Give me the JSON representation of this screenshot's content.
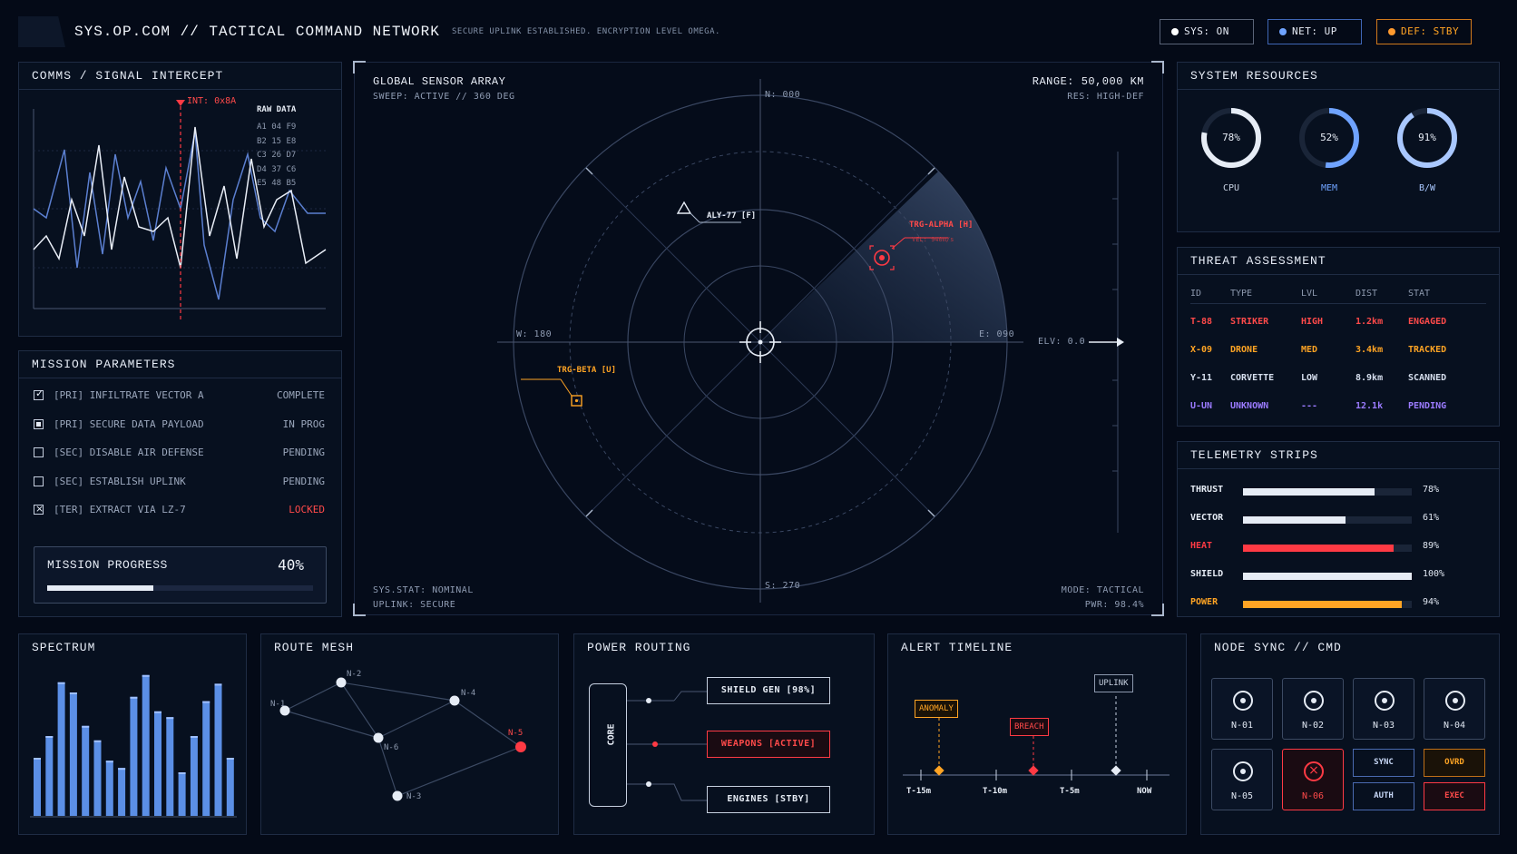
{
  "header": {
    "title": "SYS.OP.COM // TACTICAL COMMAND NETWORK",
    "message": "SECURE UPLINK ESTABLISHED. ENCRYPTION LEVEL OMEGA.",
    "status": [
      {
        "label": "SYS: ON",
        "color": "#ffffff"
      },
      {
        "label": "NET: UP",
        "color": "#6fa3ff"
      },
      {
        "label": "DEF: STBY",
        "color": "#ff9a2e"
      }
    ]
  },
  "comms": {
    "title": "COMMS / SIGNAL INTERCEPT",
    "marker": "INT: 0x8A",
    "raw_title": "RAW DATA",
    "raw_lines": [
      "A1 04 F9",
      "B2 15 E8",
      "C3 26 D7",
      "D4 37 C6",
      "E5 48 B5"
    ]
  },
  "mission": {
    "title": "MISSION PARAMETERS",
    "items": [
      {
        "label": "[PRI] INFILTRATE VECTOR A",
        "status": "COMPLETE",
        "box": "check"
      },
      {
        "label": "[PRI] SECURE DATA PAYLOAD",
        "status": "IN PROG",
        "box": "fill"
      },
      {
        "label": "[SEC] DISABLE AIR DEFENSE",
        "status": "PENDING",
        "box": "empty"
      },
      {
        "label": "[SEC] ESTABLISH UPLINK",
        "status": "PENDING",
        "box": "empty"
      },
      {
        "label": "[TER] EXTRACT VIA LZ-7",
        "status": "LOCKED",
        "box": "x"
      }
    ],
    "progress_label": "MISSION PROGRESS",
    "progress_text": "40%",
    "progress_value": 0.4
  },
  "radar": {
    "title": "GLOBAL SENSOR ARRAY",
    "sweep": "SWEEP: ACTIVE // 360 DEG",
    "range": "RANGE: 50,000 KM",
    "res": "RES: HIGH-DEF",
    "north": "N: 000",
    "south": "S: 270",
    "west": "W: 180",
    "east": "E: 090",
    "elv": "ELV: 0.0",
    "friendly": "ALY-77 [F]",
    "hostile": "TRG-ALPHA [H]",
    "hostile_vel": "VEL: 940m/s",
    "unknown": "TRG-BETA [U]",
    "sys_stat": "SYS.STAT: NOMINAL",
    "uplink": "UPLINK: SECURE",
    "mode": "MODE: TACTICAL",
    "pwr": "PWR: 98.4%"
  },
  "resources": {
    "title": "SYSTEM RESOURCES",
    "gauges": [
      {
        "label": "CPU",
        "text": "78%",
        "value": 0.78,
        "color": "#e6ecf5"
      },
      {
        "label": "MEM",
        "text": "52%",
        "value": 0.52,
        "color": "#6fa3ff"
      },
      {
        "label": "B/W",
        "text": "91%",
        "value": 0.91,
        "color": "#a9c8ff"
      }
    ]
  },
  "threats": {
    "title": "THREAT ASSESSMENT",
    "headers": [
      "ID",
      "TYPE",
      "LVL",
      "DIST",
      "STAT"
    ],
    "rows": [
      {
        "cells": [
          "T-88",
          "STRIKER",
          "HIGH",
          "1.2km",
          "ENGAGED"
        ],
        "color": "#ff4a4a"
      },
      {
        "cells": [
          "X-09",
          "DRONE",
          "MED",
          "3.4km",
          "TRACKED"
        ],
        "color": "#ffa424"
      },
      {
        "cells": [
          "Y-11",
          "CORVETTE",
          "LOW",
          "8.9km",
          "SCANNED"
        ],
        "color": "#d6dfee"
      },
      {
        "cells": [
          "U-UN",
          "UNKNOWN",
          "---",
          "12.1k",
          "PENDING"
        ],
        "color": "#9b7bff"
      }
    ]
  },
  "telemetry": {
    "title": "TELEMETRY STRIPS",
    "rows": [
      {
        "name": "THRUST",
        "text": "78%",
        "value": 0.78,
        "color": "#e6ecf5",
        "name_color": "#e6ecf5"
      },
      {
        "name": "VECTOR",
        "text": "61%",
        "value": 0.61,
        "color": "#e6ecf5",
        "name_color": "#e6ecf5"
      },
      {
        "name": "HEAT",
        "text": "89%",
        "value": 0.89,
        "color": "#ff3a44",
        "name_color": "#ff3a44"
      },
      {
        "name": "SHIELD",
        "text": "100%",
        "value": 1.0,
        "color": "#e6ecf5",
        "name_color": "#e6ecf5"
      },
      {
        "name": "POWER",
        "text": "94%",
        "value": 0.94,
        "color": "#ffa424",
        "name_color": "#ffa424"
      }
    ]
  },
  "spectrum": {
    "title": "SPECTRUM",
    "chart_data": {
      "type": "bar",
      "values": [
        0.4,
        0.55,
        0.92,
        0.85,
        0.62,
        0.52,
        0.38,
        0.33,
        0.82,
        0.97,
        0.72,
        0.68,
        0.3,
        0.55,
        0.79,
        0.91,
        0.4
      ],
      "color": "#5b8fe6"
    }
  },
  "mesh": {
    "title": "ROUTE MESH",
    "nodes": [
      "N-1",
      "N-2",
      "N-4",
      "N-5",
      "N-6",
      "N-3"
    ]
  },
  "power": {
    "title": "POWER ROUTING",
    "core": "CORE",
    "shield": "SHIELD GEN [98%]",
    "weapons": "WEAPONS [ACTIVE]",
    "engines": "ENGINES [STBY]"
  },
  "alerts": {
    "title": "ALERT TIMELINE",
    "events": [
      "ANOMALY",
      "BREACH",
      "UPLINK"
    ],
    "ticks": [
      "T-15m",
      "T-10m",
      "T-5m",
      "NOW"
    ]
  },
  "nodes": {
    "title": "NODE SYNC // CMD",
    "items": [
      "N-01",
      "N-02",
      "N-03",
      "N-04",
      "N-05",
      "N-06"
    ],
    "sync": "SYNC",
    "auth": "AUTH",
    "ovrd": "OVRD",
    "exec": "EXEC"
  }
}
